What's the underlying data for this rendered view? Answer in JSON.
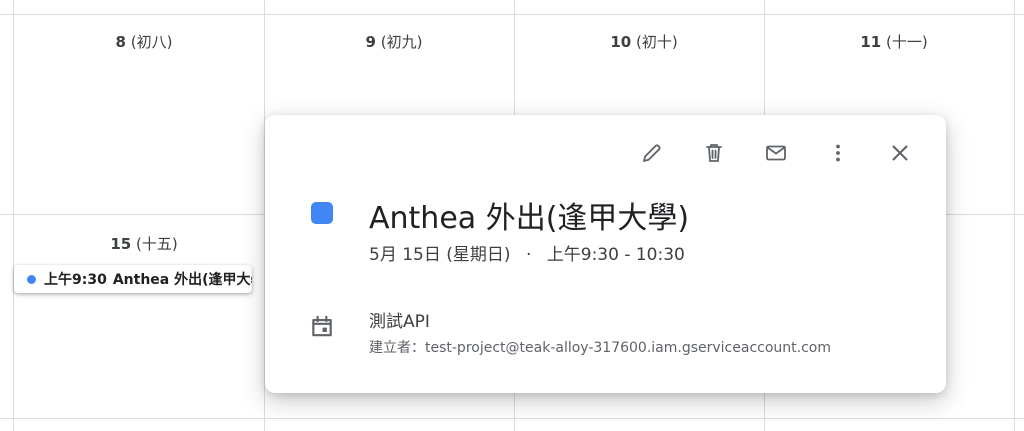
{
  "calendar": {
    "week1": [
      {
        "date": "8",
        "lunar": "(初八)"
      },
      {
        "date": "9",
        "lunar": "(初九)"
      },
      {
        "date": "10",
        "lunar": "(初十)"
      },
      {
        "date": "11",
        "lunar": "(十一)"
      }
    ],
    "week2": [
      {
        "date": "15",
        "lunar": "(十五)"
      }
    ],
    "event_chip": {
      "time": "上午9:30",
      "title": "Anthea 外出(逢甲大學)",
      "color": "#4285f4"
    }
  },
  "popup": {
    "toolbar": {
      "edit_icon": "pencil-icon",
      "delete_icon": "trash-icon",
      "email_icon": "envelope-icon",
      "more_icon": "more-vert-icon",
      "close_icon": "close-icon"
    },
    "event_color": "#4285f4",
    "title": "Anthea 外出(逢甲大學)",
    "date": "5月 15日 (星期日)",
    "separator": "·",
    "time": "上午9:30 - 10:30",
    "calendar_icon": "calendar-icon",
    "calendar_name": "測試API",
    "creator": "建立者：test-project@teak-alloy-317600.iam.gserviceaccount.com"
  }
}
